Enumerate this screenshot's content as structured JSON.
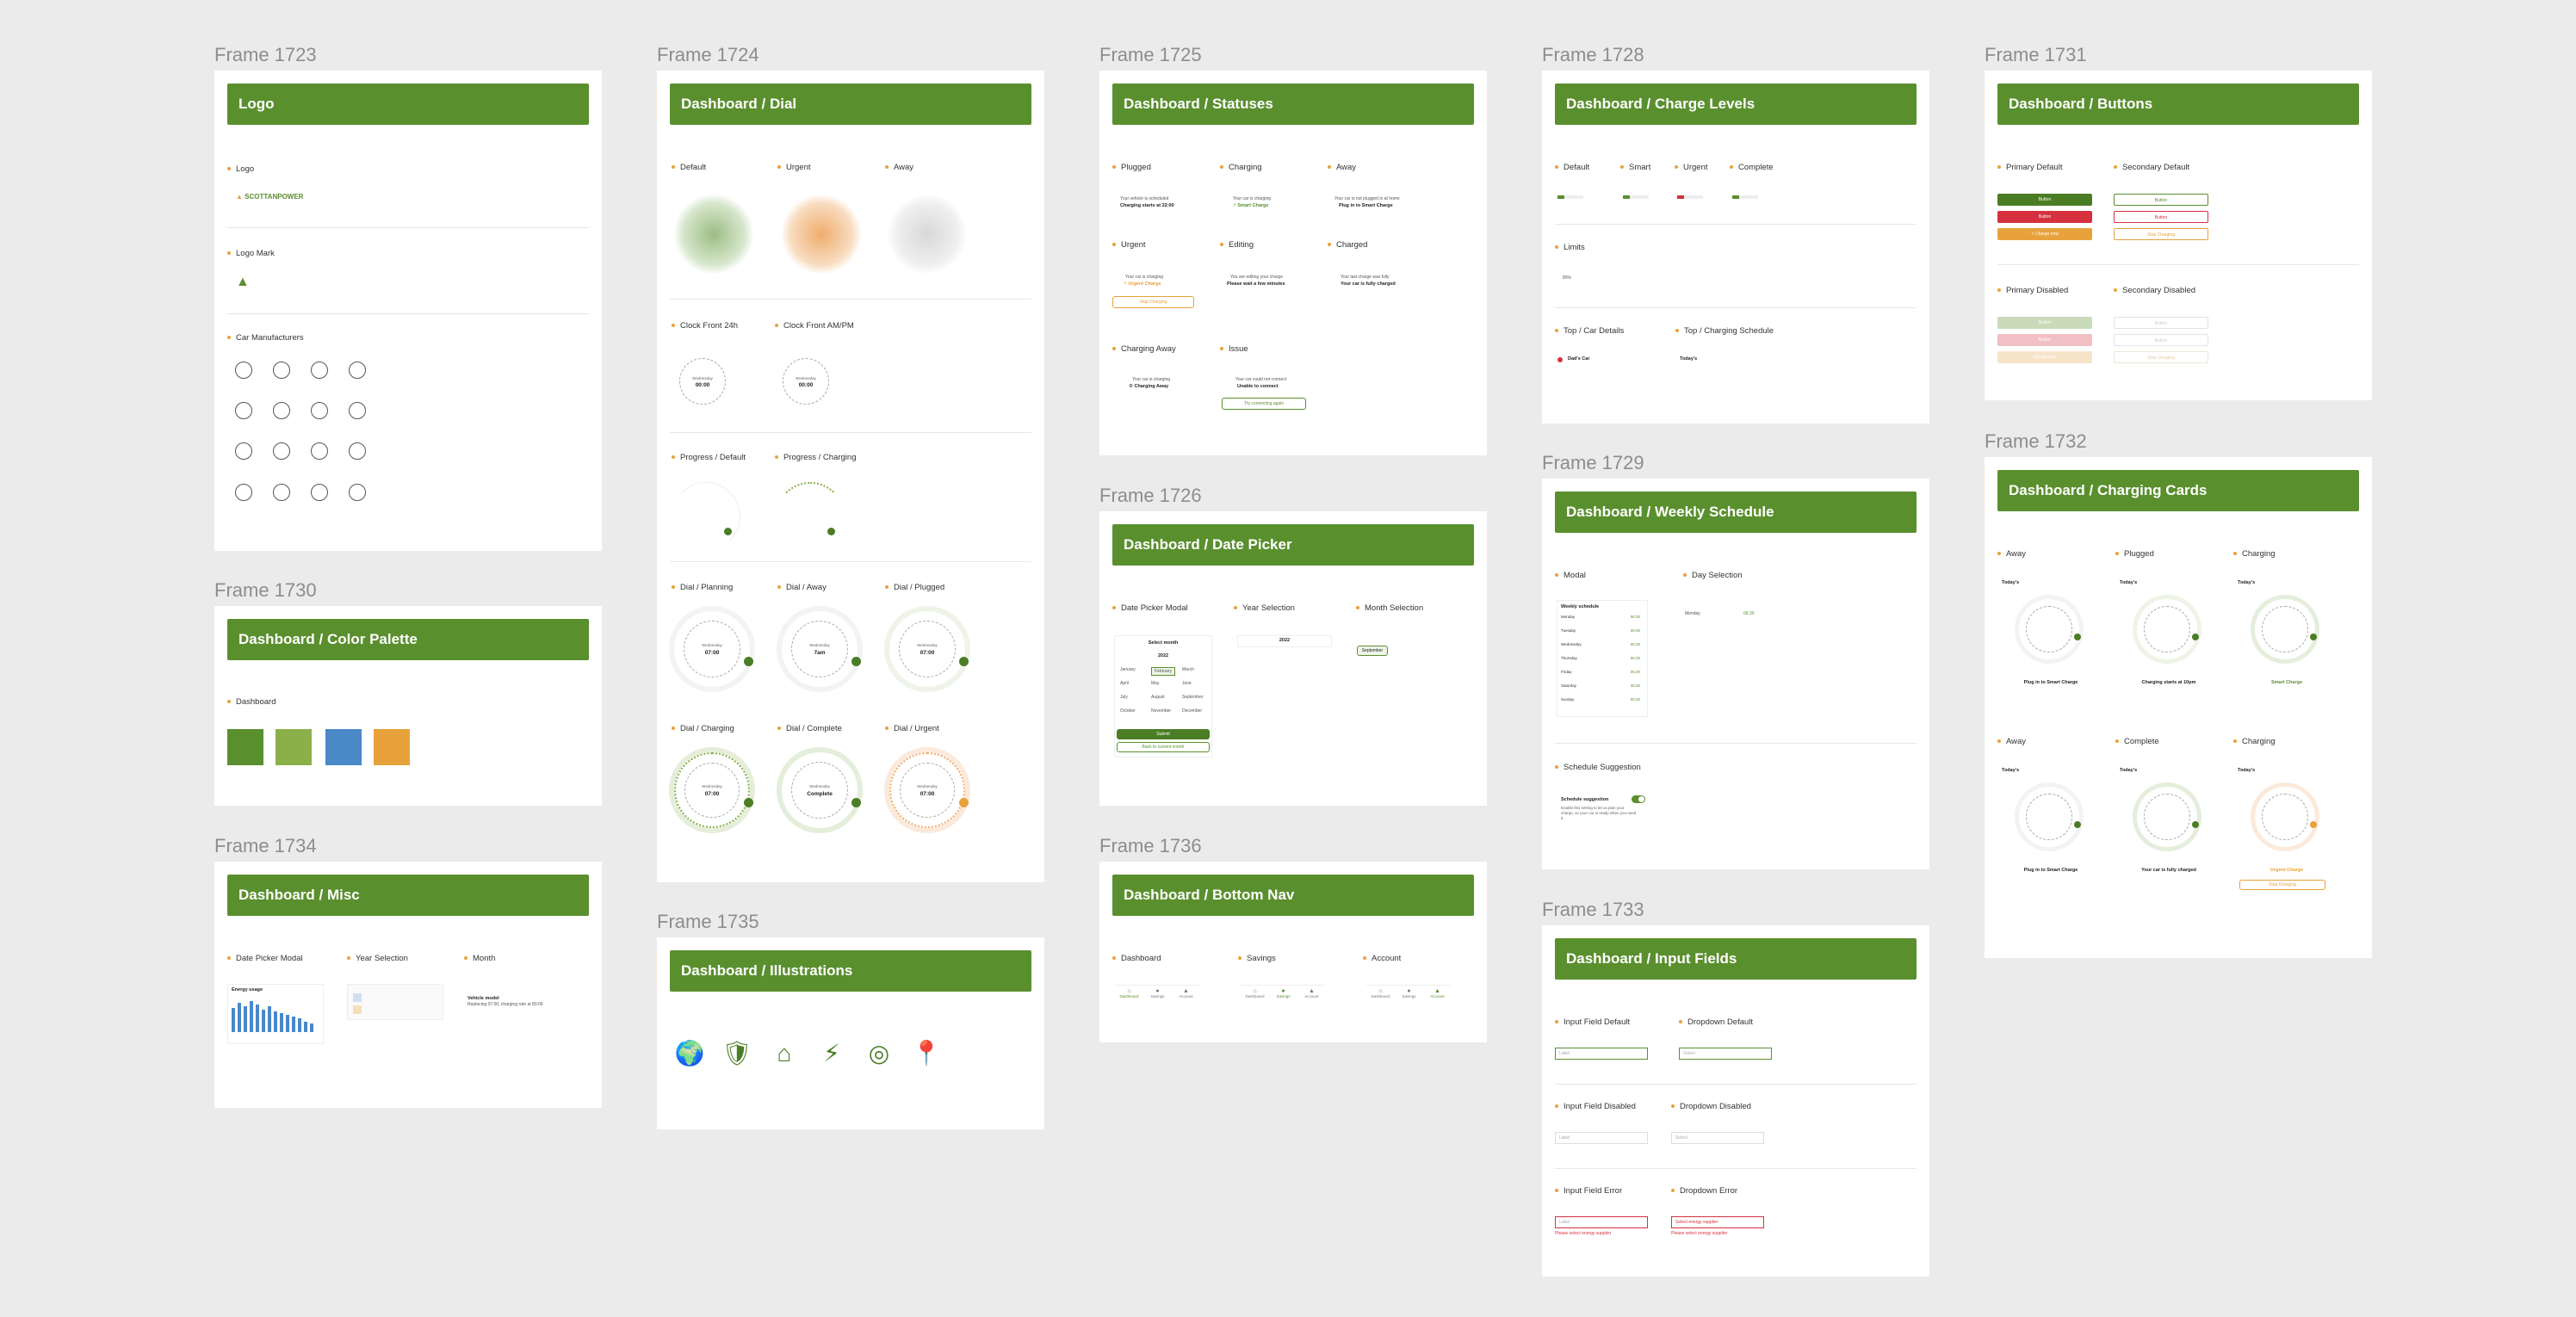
{
  "colors": {
    "brand": "#5a8f2e",
    "light": "#8bb04a",
    "blue": "#4a88c8",
    "orange": "#e8a23c",
    "red": "#d6313f",
    "bg": "#ebebeb"
  },
  "frames": {
    "f1723": {
      "label": "Frame 1723",
      "header": "Logo",
      "sections": {
        "logo": "Logo",
        "logo_mark": "Logo Mark",
        "car": "Car Manufacturers"
      },
      "logo_text": "SCOTTANPOWER",
      "car_icons": [
        "tesla-logo-icon",
        "bmw-logo-icon",
        "seat-logo-icon",
        "volkswagen-logo-icon",
        "audi-logo-icon",
        "hyundai-logo-icon",
        "fiat-logo-icon",
        "peugeot-logo-icon",
        "polestar-logo-icon",
        "renault-logo-icon",
        "cupra-logo-icon",
        "porsche-logo-icon",
        "skoda-logo-icon",
        "volvo-logo-icon",
        "jaguar-logo-icon",
        "mini-logo-icon"
      ]
    },
    "f1730": {
      "label": "Frame 1730",
      "header": "Dashboard / Color Palette",
      "section": "Dashboard"
    },
    "f1734": {
      "label": "Frame 1734",
      "header": "Dashboard / Misc",
      "sections": {
        "dpm": "Date Picker Modal",
        "year": "Year Selection",
        "month": "Month"
      },
      "energy": "Energy usage",
      "month_text": "Vehicle model",
      "month_sub": "Replacing 07:00, charging rate at 80:00"
    },
    "f1724": {
      "label": "Frame 1724",
      "header": "Dashboard / Dial",
      "sections": {
        "default": "Default",
        "urgent": "Urgent",
        "away": "Away",
        "c24": "Clock Front 24h",
        "cam": "Clock Front AM/PM",
        "pdef": "Progress / Default",
        "pchg": "Progress / Charging",
        "dplan": "Dial / Planning",
        "daway": "Dial / Away",
        "dplug": "Dial / Plugged",
        "dchg": "Dial / Charging",
        "dcomp": "Dial / Complete",
        "durg": "Dial / Urgent"
      },
      "dial_small": "Wednesday",
      "times": {
        "t0000": "00:00",
        "t0700": "07:00",
        "t7am": "7am",
        "complete": "Complete"
      }
    },
    "f1735": {
      "label": "Frame 1735",
      "header": "Dashboard / Illustrations",
      "icons": [
        "globe-illustration",
        "shield-car-illustration",
        "house-plug-illustration",
        "charger-illustration",
        "target-illustration",
        "location-car-illustration"
      ]
    },
    "f1725": {
      "label": "Frame 1725",
      "header": "Dashboard / Statuses",
      "sections": {
        "plugged": "Plugged",
        "charging": "Charging",
        "away": "Away",
        "urgent": "Urgent",
        "editing": "Editing",
        "charged": "Charged",
        "caway": "Charging Away",
        "issue": "Issue"
      },
      "texts": {
        "plugged_a": "Your vehicle is scheduled",
        "plugged_b": "Charging starts at 22:00",
        "charging_a": "Your car is charging",
        "charging_b": "Smart Charge",
        "away_a": "Your car is not plugged in at home",
        "away_b": "Plug in to Smart Charge",
        "urgent_a": "Your car is charging",
        "urgent_b": "Urgent Charge",
        "urgent_btn": "Stop Charging",
        "editing_a": "You are editing your charge",
        "editing_b": "Please wait a few minutes",
        "charged_a": "Your last charge was fully",
        "charged_b": "Your car is fully charged",
        "caway_a": "Your car is charging",
        "caway_b": "Charging Away",
        "issue_a": "Your car could not connect",
        "issue_b": "Unable to connect",
        "issue_btn": "Try connecting again"
      }
    },
    "f1726": {
      "label": "Frame 1726",
      "header": "Dashboard / Date Picker",
      "sections": {
        "dpm": "Date Picker Modal",
        "year": "Year Selection",
        "month": "Month Selection"
      },
      "select_month": "Select month",
      "year": "2022",
      "month_selected": "September",
      "months": [
        "January",
        "February",
        "March",
        "April",
        "May",
        "June",
        "July",
        "August",
        "September",
        "October",
        "November",
        "December"
      ],
      "submit": "Submit",
      "back": "Back to current month"
    },
    "f1736": {
      "label": "Frame 1736",
      "header": "Dashboard / Bottom Nav",
      "sections": {
        "dash": "Dashboard",
        "savings": "Savings",
        "account": "Account"
      },
      "nav": [
        "Dashboard",
        "Savings",
        "Account"
      ]
    },
    "f1728": {
      "label": "Frame 1728",
      "header": "Dashboard / Charge Levels",
      "sections": {
        "default": "Default",
        "smart": "Smart",
        "urgent": "Urgent",
        "complete": "Complete",
        "limits": "Limits",
        "topcar": "Top / Car Details",
        "topsched": "Top / Charging Schedule"
      },
      "car_name": "Dad's Car",
      "todays": "Today's",
      "val": "80%"
    },
    "f1729": {
      "label": "Frame 1729",
      "header": "Dashboard / Weekly Schedule",
      "sections": {
        "modal": "Modal",
        "day": "Day Selection",
        "sugg": "Schedule Suggestion"
      },
      "days": [
        "Monday",
        "Tuesday",
        "Wednesday",
        "Thursday",
        "Friday",
        "Saturday",
        "Sunday"
      ],
      "day_time": "06:30",
      "modal_title": "Weekly schedule",
      "sugg_title": "Schedule suggestion",
      "sugg_text": "Enable this setting to let us plan your charge, so your car is ready when you need it."
    },
    "f1733": {
      "label": "Frame 1733",
      "header": "Dashboard / Input Fields",
      "sections": {
        "ifd": "Input Field Default",
        "ddd": "Dropdown Default",
        "ifdis": "Input Field Disabled",
        "dddis": "Dropdown Disabled",
        "iferr": "Input Field Error",
        "dderr": "Dropdown Error"
      },
      "placeholder": "Label",
      "select_placeholder": "Select",
      "select_supplier": "Select energy supplier",
      "err_text": "Please select energy supplier"
    },
    "f1731": {
      "label": "Frame 1731",
      "header": "Dashboard / Buttons",
      "sections": {
        "pdef": "Primary Default",
        "sdef": "Secondary Default",
        "pdis": "Primary Disabled",
        "sdis": "Secondary Disabled"
      },
      "btn": "Button",
      "charge_now": "Charge now",
      "stop": "Stop Charging"
    },
    "f1732": {
      "label": "Frame 1732",
      "header": "Dashboard / Charging Cards",
      "sections": {
        "away": "Away",
        "plugged": "Plugged",
        "charging": "Charging",
        "away2": "Away",
        "complete": "Complete",
        "charging2": "Charging"
      },
      "todays": "Today's",
      "card_texts": {
        "away": "Plug in to Smart Charge",
        "plugged": "Charging starts at 10pm",
        "charging": "Smart Charge",
        "complete": "Your car is fully charged",
        "urgent": "Urgent Charge",
        "stop": "Stop Charging"
      }
    }
  }
}
